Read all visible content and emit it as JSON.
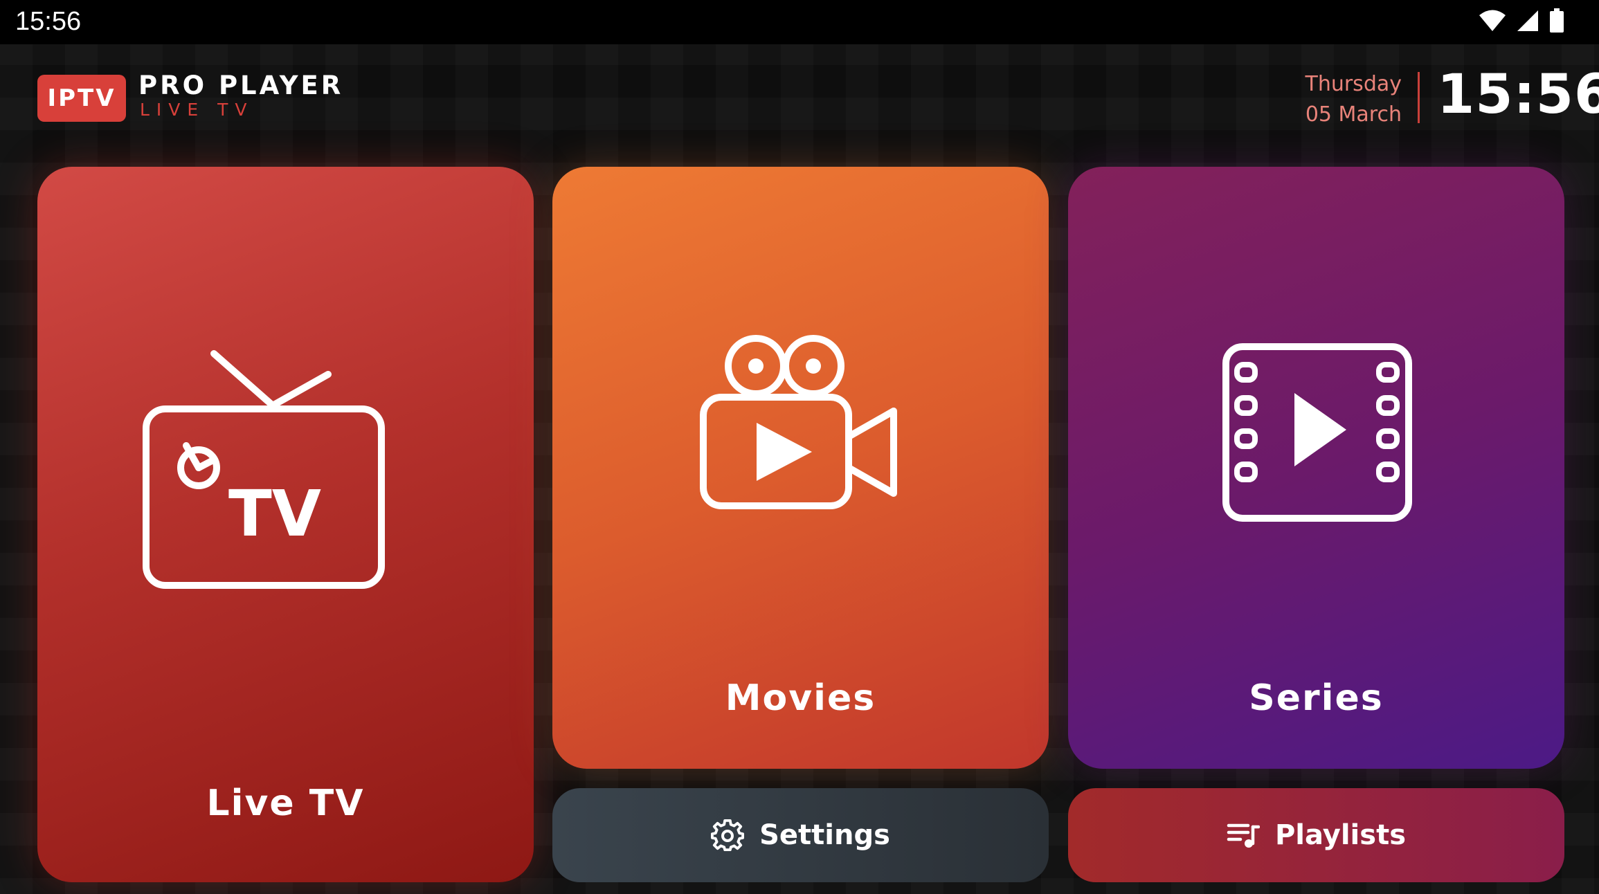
{
  "status_bar": {
    "time": "15:56",
    "icons": [
      "wifi-icon",
      "signal-icon",
      "battery-icon"
    ]
  },
  "header": {
    "logo_badge": "IPTV",
    "logo_title": "PRO PLAYER",
    "logo_subtitle": "LIVE TV",
    "day": "Thursday",
    "date": "05 March",
    "clock": "15:56"
  },
  "tiles": {
    "live_tv": {
      "label": "Live TV",
      "icon_text": "TV",
      "icon": "tv-icon"
    },
    "movies": {
      "label": "Movies",
      "icon": "movie-camera-icon"
    },
    "series": {
      "label": "Series",
      "icon": "film-strip-icon"
    }
  },
  "buttons": {
    "settings": {
      "label": "Settings",
      "icon": "gear-icon"
    },
    "playlists": {
      "label": "Playlists",
      "icon": "playlist-icon"
    }
  },
  "colors": {
    "accent_red": "#d8403a",
    "live_tv_tile": "#b3302b",
    "movies_tile": "#dc5c2d",
    "series_tile": "#6b1a6a",
    "settings_button": "#333b43",
    "playlists_button": "#9a2538"
  }
}
